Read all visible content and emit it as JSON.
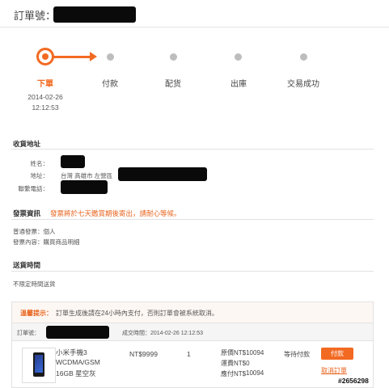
{
  "header": {
    "order_no_label": "訂單號：5"
  },
  "steps": [
    {
      "label": "下單",
      "date": "2014-02-26",
      "time": "12:12:53"
    },
    {
      "label": "付款"
    },
    {
      "label": "配货"
    },
    {
      "label": "出庫"
    },
    {
      "label": "交易成功"
    }
  ],
  "shipping": {
    "title": "收貨地址",
    "name_label": "姓名：",
    "address_label": "地址：",
    "address_value": "台灣 高雄市 左營區",
    "phone_label": "聯繫電話："
  },
  "invoice": {
    "title": "發票資訊",
    "notice": "發票將於七天鑑賞期後寄出，請耐心等候。",
    "type_line": "普通發票：個人",
    "content_line": "發票內容：購買商品明細"
  },
  "delivery": {
    "title": "送貨時間",
    "value": "不限定時間送貨"
  },
  "order": {
    "notice_prefix": "溫馨提示：",
    "notice_text": "訂單生成後請在24小時內支付，否則訂單會被系統取消。",
    "order_no_label": "訂單號：",
    "created_label": "成交時間：2014-02-26 12:12:53",
    "product_name_1": "小米手機3",
    "product_name_2": "WCDMA/GSM",
    "product_name_3": "16GB 星空灰",
    "unit_price": "NT$9999",
    "quantity": "1",
    "original_price": "原價NT$10094",
    "shipping_fee": "運費NT$0",
    "pay_label": "應付NT$",
    "pay_amount": "10094",
    "status": "等待付款",
    "pay_button": "付款",
    "cancel_link": "取消訂單"
  },
  "watermark": "#2656298",
  "colors": {
    "accent": "#f26a22",
    "inactive_dot": "#bdbdbd",
    "divider": "#e2e2e2"
  }
}
